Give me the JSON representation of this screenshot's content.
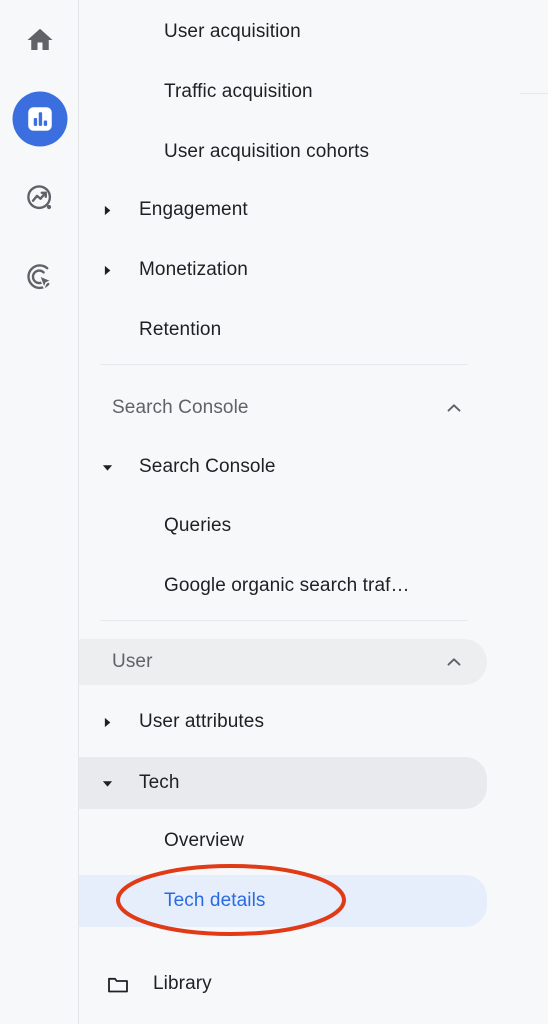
{
  "rail": {
    "items": [
      {
        "name": "home",
        "icon": "home-icon",
        "label": "Home",
        "active": false
      },
      {
        "name": "reports",
        "icon": "bar-chart-icon",
        "label": "Reports",
        "active": true
      },
      {
        "name": "explore",
        "icon": "explore-trending-icon",
        "label": "Explore",
        "active": false
      },
      {
        "name": "advertising",
        "icon": "advertising-target-cursor-icon",
        "label": "Advertising",
        "active": false
      }
    ],
    "active_color": "#3b6fe0",
    "icon_color": "#5f6368"
  },
  "nav": {
    "items": [
      {
        "label": "User acquisition",
        "level": "sub",
        "expander": "none",
        "state": "normal"
      },
      {
        "label": "Traffic acquisition",
        "level": "sub",
        "expander": "none",
        "state": "normal"
      },
      {
        "label": "User acquisition cohorts",
        "level": "sub",
        "expander": "none",
        "state": "normal"
      },
      {
        "label": "Engagement",
        "level": "top",
        "expander": "collapsed",
        "state": "normal"
      },
      {
        "label": "Monetization",
        "level": "top",
        "expander": "collapsed",
        "state": "normal"
      },
      {
        "label": "Retention",
        "level": "top",
        "expander": "none",
        "state": "normal"
      }
    ],
    "search_console_section": {
      "label": "Search Console",
      "chevron": "chevron-up-icon",
      "shaded": false,
      "items": [
        {
          "label": "Search Console",
          "level": "top",
          "expander": "expanded",
          "state": "normal"
        },
        {
          "label": "Queries",
          "level": "sub",
          "expander": "none",
          "state": "normal"
        },
        {
          "label": "Google organic search traf…",
          "level": "sub",
          "expander": "none",
          "state": "normal"
        }
      ]
    },
    "user_section": {
      "label": "User",
      "chevron": "chevron-up-icon",
      "shaded": true,
      "items": [
        {
          "label": "User attributes",
          "level": "top",
          "expander": "collapsed",
          "state": "normal"
        },
        {
          "label": "Tech",
          "level": "top",
          "expander": "expanded",
          "state": "group-selected"
        },
        {
          "label": "Overview",
          "level": "sub",
          "expander": "none",
          "state": "normal"
        },
        {
          "label": "Tech details",
          "level": "sub",
          "expander": "none",
          "state": "selected"
        }
      ]
    },
    "library": {
      "label": "Library",
      "icon": "folder-icon"
    }
  },
  "annotation": {
    "shape": "ellipse",
    "target": "Tech details",
    "color": "#e03a17",
    "stroke_width": 4
  },
  "colors": {
    "page_bg": "#f7f8fa",
    "selected_pill": "#e6eefc",
    "selected_text": "#2a6ae1",
    "group_pill": "#e8eaed",
    "section_shaded": "#eceef0",
    "text": "#1f2023",
    "muted_text": "#5f6368",
    "divider": "#e5e7ea"
  }
}
